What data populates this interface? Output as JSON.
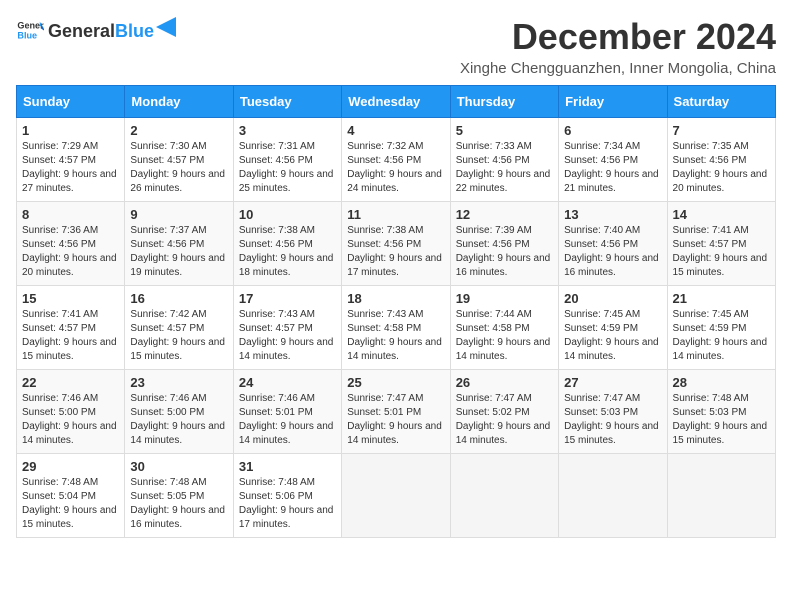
{
  "logo": {
    "general": "General",
    "blue": "Blue"
  },
  "title": "December 2024",
  "location": "Xinghe Chengguanzhen, Inner Mongolia, China",
  "weekdays": [
    "Sunday",
    "Monday",
    "Tuesday",
    "Wednesday",
    "Thursday",
    "Friday",
    "Saturday"
  ],
  "weeks": [
    [
      {
        "day": "1",
        "sunrise": "7:29 AM",
        "sunset": "4:57 PM",
        "daylight": "9 hours and 27 minutes."
      },
      {
        "day": "2",
        "sunrise": "7:30 AM",
        "sunset": "4:57 PM",
        "daylight": "9 hours and 26 minutes."
      },
      {
        "day": "3",
        "sunrise": "7:31 AM",
        "sunset": "4:56 PM",
        "daylight": "9 hours and 25 minutes."
      },
      {
        "day": "4",
        "sunrise": "7:32 AM",
        "sunset": "4:56 PM",
        "daylight": "9 hours and 24 minutes."
      },
      {
        "day": "5",
        "sunrise": "7:33 AM",
        "sunset": "4:56 PM",
        "daylight": "9 hours and 22 minutes."
      },
      {
        "day": "6",
        "sunrise": "7:34 AM",
        "sunset": "4:56 PM",
        "daylight": "9 hours and 21 minutes."
      },
      {
        "day": "7",
        "sunrise": "7:35 AM",
        "sunset": "4:56 PM",
        "daylight": "9 hours and 20 minutes."
      }
    ],
    [
      {
        "day": "8",
        "sunrise": "7:36 AM",
        "sunset": "4:56 PM",
        "daylight": "9 hours and 20 minutes."
      },
      {
        "day": "9",
        "sunrise": "7:37 AM",
        "sunset": "4:56 PM",
        "daylight": "9 hours and 19 minutes."
      },
      {
        "day": "10",
        "sunrise": "7:38 AM",
        "sunset": "4:56 PM",
        "daylight": "9 hours and 18 minutes."
      },
      {
        "day": "11",
        "sunrise": "7:38 AM",
        "sunset": "4:56 PM",
        "daylight": "9 hours and 17 minutes."
      },
      {
        "day": "12",
        "sunrise": "7:39 AM",
        "sunset": "4:56 PM",
        "daylight": "9 hours and 16 minutes."
      },
      {
        "day": "13",
        "sunrise": "7:40 AM",
        "sunset": "4:56 PM",
        "daylight": "9 hours and 16 minutes."
      },
      {
        "day": "14",
        "sunrise": "7:41 AM",
        "sunset": "4:57 PM",
        "daylight": "9 hours and 15 minutes."
      }
    ],
    [
      {
        "day": "15",
        "sunrise": "7:41 AM",
        "sunset": "4:57 PM",
        "daylight": "9 hours and 15 minutes."
      },
      {
        "day": "16",
        "sunrise": "7:42 AM",
        "sunset": "4:57 PM",
        "daylight": "9 hours and 15 minutes."
      },
      {
        "day": "17",
        "sunrise": "7:43 AM",
        "sunset": "4:57 PM",
        "daylight": "9 hours and 14 minutes."
      },
      {
        "day": "18",
        "sunrise": "7:43 AM",
        "sunset": "4:58 PM",
        "daylight": "9 hours and 14 minutes."
      },
      {
        "day": "19",
        "sunrise": "7:44 AM",
        "sunset": "4:58 PM",
        "daylight": "9 hours and 14 minutes."
      },
      {
        "day": "20",
        "sunrise": "7:45 AM",
        "sunset": "4:59 PM",
        "daylight": "9 hours and 14 minutes."
      },
      {
        "day": "21",
        "sunrise": "7:45 AM",
        "sunset": "4:59 PM",
        "daylight": "9 hours and 14 minutes."
      }
    ],
    [
      {
        "day": "22",
        "sunrise": "7:46 AM",
        "sunset": "5:00 PM",
        "daylight": "9 hours and 14 minutes."
      },
      {
        "day": "23",
        "sunrise": "7:46 AM",
        "sunset": "5:00 PM",
        "daylight": "9 hours and 14 minutes."
      },
      {
        "day": "24",
        "sunrise": "7:46 AM",
        "sunset": "5:01 PM",
        "daylight": "9 hours and 14 minutes."
      },
      {
        "day": "25",
        "sunrise": "7:47 AM",
        "sunset": "5:01 PM",
        "daylight": "9 hours and 14 minutes."
      },
      {
        "day": "26",
        "sunrise": "7:47 AM",
        "sunset": "5:02 PM",
        "daylight": "9 hours and 14 minutes."
      },
      {
        "day": "27",
        "sunrise": "7:47 AM",
        "sunset": "5:03 PM",
        "daylight": "9 hours and 15 minutes."
      },
      {
        "day": "28",
        "sunrise": "7:48 AM",
        "sunset": "5:03 PM",
        "daylight": "9 hours and 15 minutes."
      }
    ],
    [
      {
        "day": "29",
        "sunrise": "7:48 AM",
        "sunset": "5:04 PM",
        "daylight": "9 hours and 15 minutes."
      },
      {
        "day": "30",
        "sunrise": "7:48 AM",
        "sunset": "5:05 PM",
        "daylight": "9 hours and 16 minutes."
      },
      {
        "day": "31",
        "sunrise": "7:48 AM",
        "sunset": "5:06 PM",
        "daylight": "9 hours and 17 minutes."
      },
      null,
      null,
      null,
      null
    ]
  ],
  "labels": {
    "sunrise": "Sunrise:",
    "sunset": "Sunset:",
    "daylight": "Daylight:"
  }
}
